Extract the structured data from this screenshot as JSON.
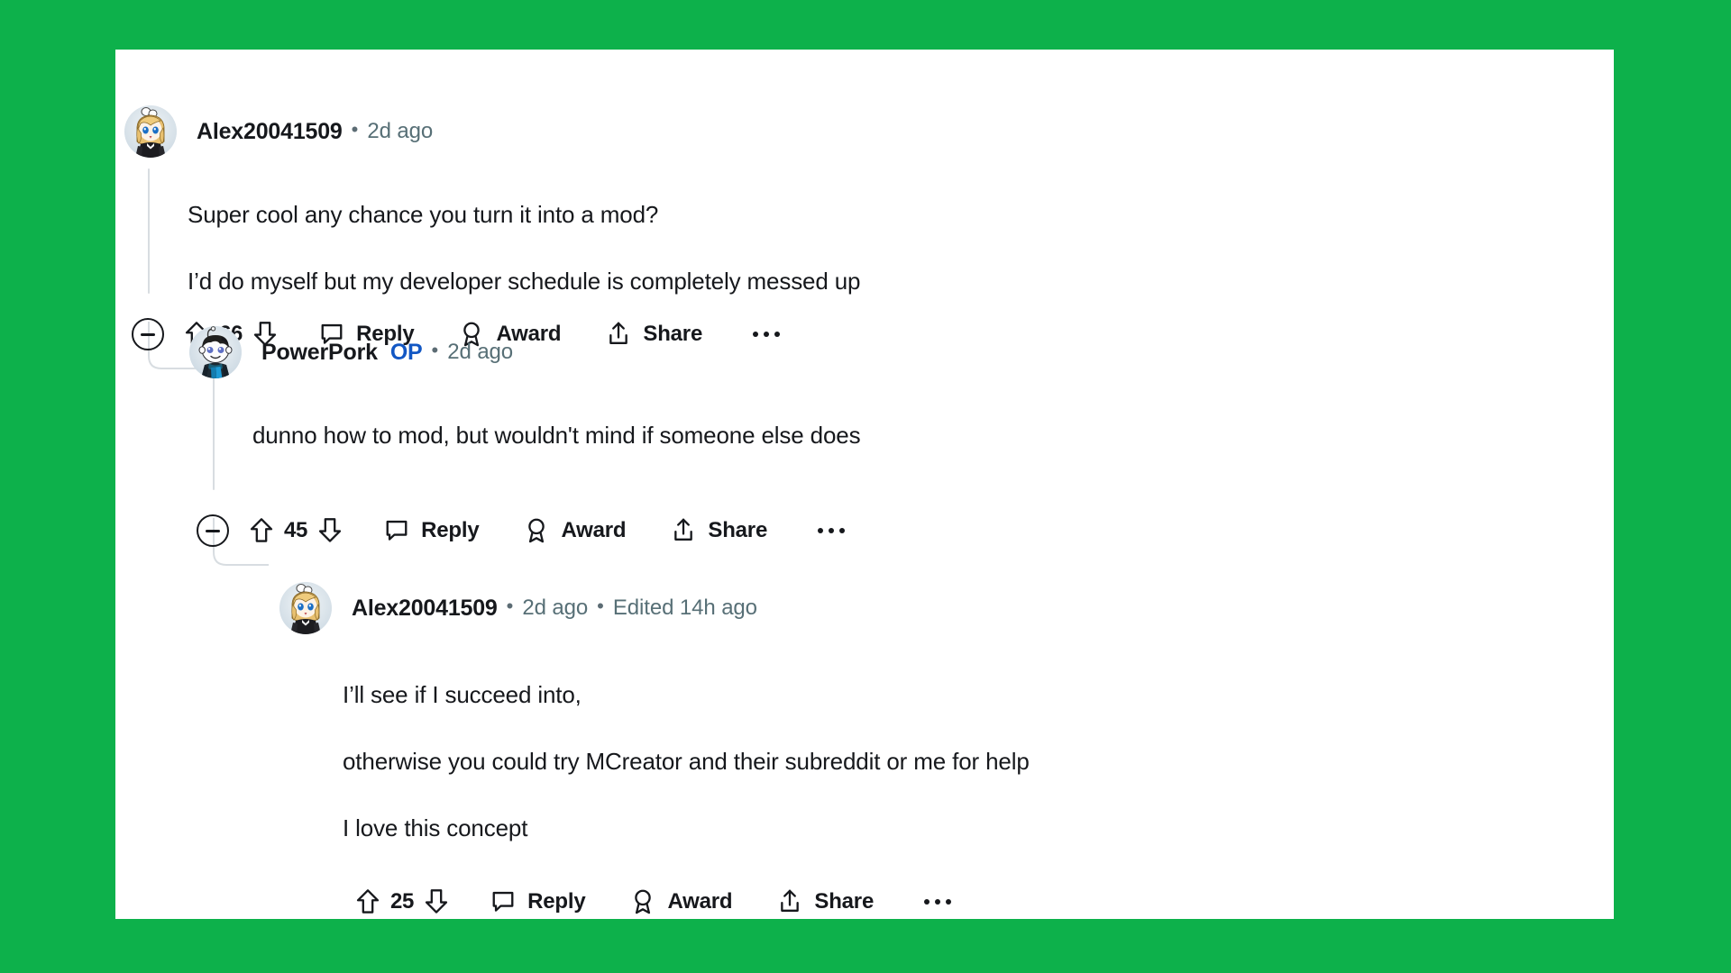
{
  "theme": {
    "page_background": "#0DB14B",
    "card_background": "#FFFFFF",
    "text_color": "#16181C",
    "meta_color": "#576F76",
    "op_badge_color": "#1257C4",
    "thread_line_color": "#D8DDE1"
  },
  "comments": [
    {
      "id": "comment-1",
      "depth": 0,
      "author": "Alex20041509",
      "op": false,
      "separator": "•",
      "timestamp": "2d ago",
      "edited": null,
      "avatar": "alex-avatar",
      "paragraphs": [
        "Super cool any chance you turn it into a mod?",
        "I’d do myself but my developer schedule is completely messed up"
      ],
      "actions": {
        "has_collapse": true,
        "collapse_label": "Collapse thread",
        "score": "66",
        "upvote_label": "Upvote",
        "downvote_label": "Downvote",
        "reply_label": "Reply",
        "award_label": "Award",
        "share_label": "Share",
        "more_label": "More options"
      }
    },
    {
      "id": "comment-2",
      "depth": 1,
      "author": "PowerPork",
      "op": true,
      "op_label": "OP",
      "separator": "•",
      "timestamp": "2d ago",
      "edited": null,
      "avatar": "powerpork-avatar",
      "paragraphs": [
        "dunno how to mod, but wouldn't mind if someone else does"
      ],
      "actions": {
        "has_collapse": true,
        "collapse_label": "Collapse thread",
        "score": "45",
        "upvote_label": "Upvote",
        "downvote_label": "Downvote",
        "reply_label": "Reply",
        "award_label": "Award",
        "share_label": "Share",
        "more_label": "More options"
      }
    },
    {
      "id": "comment-3",
      "depth": 2,
      "author": "Alex20041509",
      "op": false,
      "separator": "•",
      "timestamp": "2d ago",
      "edited": "Edited 14h ago",
      "avatar": "alex-avatar",
      "paragraphs": [
        "I’ll see if I succeed into,",
        "otherwise you could try MCreator and their subreddit or me for help",
        "I love this concept"
      ],
      "actions": {
        "has_collapse": false,
        "score": "25",
        "upvote_label": "Upvote",
        "downvote_label": "Downvote",
        "reply_label": "Reply",
        "award_label": "Award",
        "share_label": "Share",
        "more_label": "More options"
      }
    }
  ]
}
